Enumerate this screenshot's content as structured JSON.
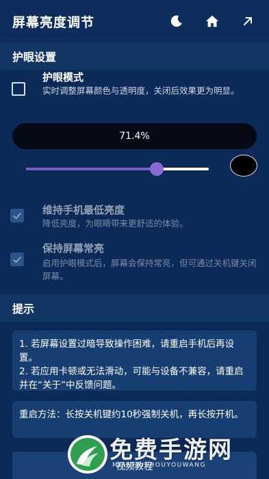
{
  "appbar": {
    "title": "屏幕亮度调节",
    "icons": [
      "moon-icon",
      "home-icon",
      "arrow-up-right-icon"
    ]
  },
  "eye_protection": {
    "header": "护眼设置",
    "mode": {
      "title": "护眼模式",
      "desc": "实时调整屏幕颜色与透明度，关闭后效果更为明显。",
      "checked": false
    },
    "brightness_percent_label": "71.4%",
    "brightness_level": 0.714,
    "filter_color": "#000000",
    "keep_min": {
      "title": "维持手机最低亮度",
      "desc": "降低亮度，为眼睛带来更舒适的体验。",
      "checked": true
    },
    "keep_on": {
      "title": "保持屏幕常亮",
      "desc": "启用护眼模式后，屏幕会保持常亮，但可通过关机键关闭屏幕。",
      "checked": true
    }
  },
  "tips": {
    "header": "提示",
    "card1": "1. 若屏幕设置过暗导致操作困难，请重启手机后再设置。\n2. 若应用卡顿或无法滑动，可能与设备不兼容，请重启并在“关于”中反馈问题。",
    "card2": "重启方法：长按关机键约10秒强制关机，再长按开机。"
  },
  "bottom_button": "视频教程",
  "watermark": {
    "title": "免费手游网",
    "subtitle": "MIANFEISHOUYOUWANG"
  },
  "colors": {
    "background": "#0c2a57",
    "accent": "#7d5cc6",
    "checkbox": "#3f79b8"
  }
}
